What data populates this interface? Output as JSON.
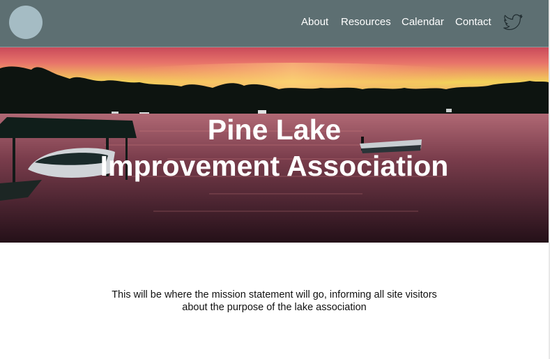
{
  "nav": {
    "items": [
      {
        "label": "About"
      },
      {
        "label": "Resources"
      },
      {
        "label": "Calendar"
      },
      {
        "label": "Contact"
      }
    ],
    "social_icon": "twitter-bird-icon"
  },
  "hero": {
    "title_line1": "Pine Lake",
    "title_line2": "Improvement Association",
    "image": "sunset-lake-photo"
  },
  "mission": {
    "line1": "This will be where the mission statement will go, informing all site visitors",
    "line2": "about the purpose of the lake association"
  },
  "colors": {
    "header_bg": "#5d6f72",
    "logo": "#a5bcc4",
    "hero_text": "#ffffff"
  }
}
